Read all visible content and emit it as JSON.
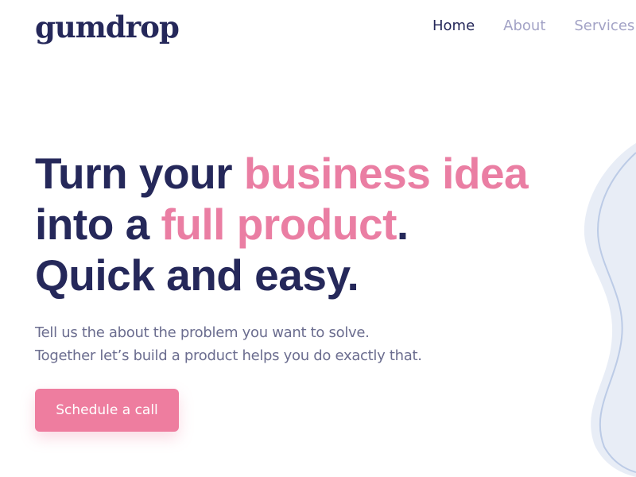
{
  "brand": {
    "logo_text": "gumdrop"
  },
  "nav": {
    "items": [
      {
        "label": "Home",
        "active": true
      },
      {
        "label": "About",
        "active": false
      },
      {
        "label": "Services",
        "active": false
      }
    ]
  },
  "hero": {
    "line1_plain": "Turn your ",
    "line1_highlight": "business idea",
    "line2_plain": "into a ",
    "line2_highlight": "full product",
    "line2_end": ".",
    "line3": "Quick and easy.",
    "subtitle_line1": "Tell us the about the problem you want to solve.",
    "subtitle_line2": "Together let’s build a product helps you do exactly that.",
    "cta_label": "Schedule a call"
  },
  "colors": {
    "primary_text": "#25285a",
    "accent_pink": "#ea7ea3",
    "nav_inactive": "#a3a3c6",
    "subtitle": "#6b6d8f",
    "blob_fill": "#e8edf6",
    "blob_stroke": "#bccbe6"
  }
}
